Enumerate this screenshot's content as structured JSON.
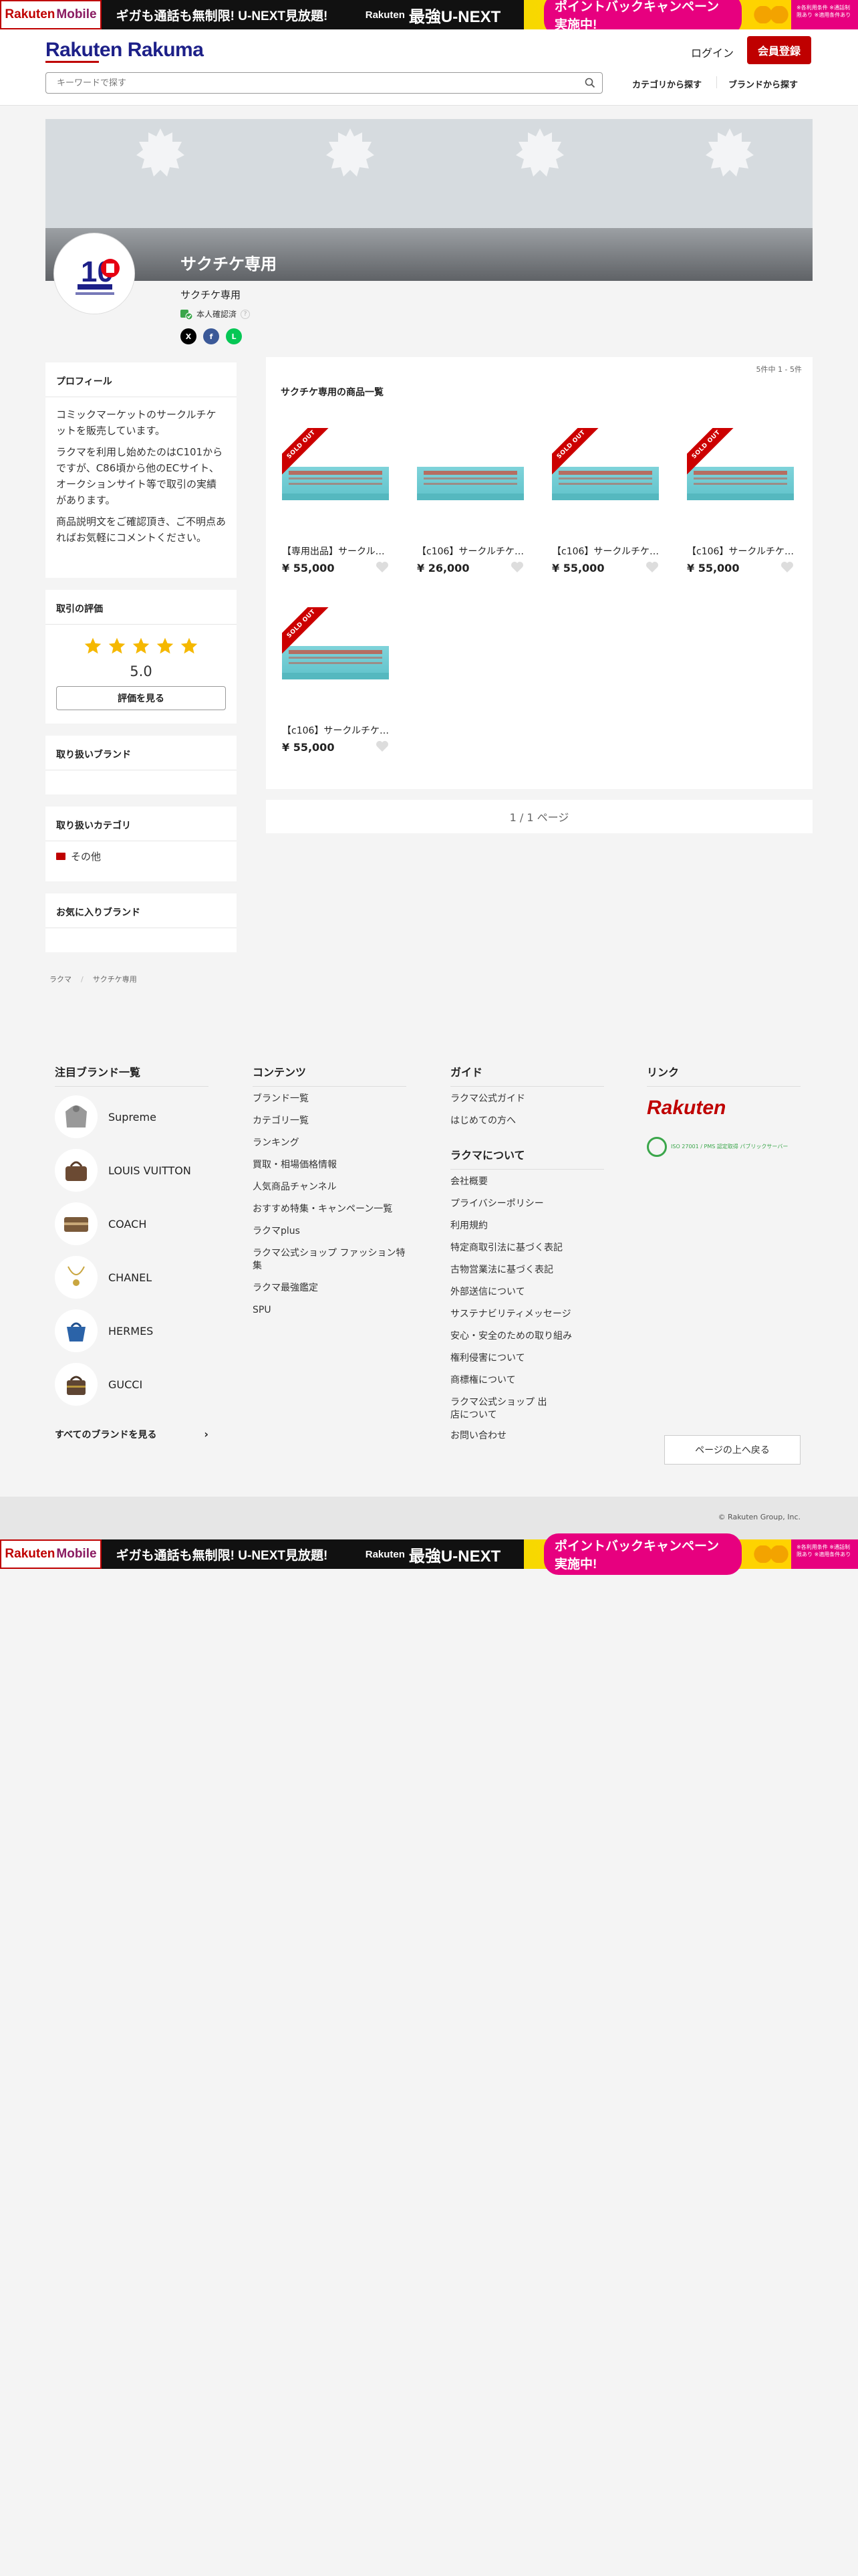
{
  "promo": {
    "rm_logo_a": "Rakuten",
    "rm_logo_b": "Mobile",
    "text1": "ギガも通話も無制限! U-NEXT見放題!",
    "text2_prefix": "Rakuten",
    "text2": "最強U-NEXT",
    "campaign": "ポイントバックキャンペーン実施中!",
    "fineprint": "※各利用条件 ※通話制限あり ※適用条件あり"
  },
  "header": {
    "brand": "Rakuten Rakuma",
    "login": "ログイン",
    "signup": "会員登録",
    "search_placeholder": "キーワードで探す",
    "nav_category": "カテゴリから探す",
    "nav_brand": "ブランドから探す"
  },
  "shop": {
    "cover_title": "サクチケ専用",
    "name": "サクチケ専用",
    "verified": "本人確認済",
    "share_x": "X",
    "share_fb": "f",
    "share_line": "L"
  },
  "profile": {
    "title": "プロフィール",
    "p1": "コミックマーケットのサークルチケットを販売しています。",
    "p2": "ラクマを利用し始めたのはC101からですが、C86頃から他のECサイト、オークションサイト等で取引の実績があります。",
    "p3": "商品説明文をご確認頂き、ご不明点あればお気軽にコメントください。"
  },
  "rating": {
    "title": "取引の評価",
    "value": "5.0",
    "stars": 5,
    "button": "評価を見る"
  },
  "brands_card": {
    "title": "取り扱いブランド"
  },
  "categories_card": {
    "title": "取り扱いカテゴリ",
    "items": [
      "その他"
    ]
  },
  "fav_brands_card": {
    "title": "お気に入りブランド"
  },
  "products": {
    "count": "5件中 1 - 5件",
    "title": "サクチケ専用の商品一覧",
    "soldout_label": "SOLD OUT",
    "items": [
      {
        "name": "【専用出品】サークルチケット",
        "price": "¥ 55,000",
        "sold_out": true
      },
      {
        "name": "【c106】サークルチケット",
        "price": "¥ 26,000",
        "sold_out": false
      },
      {
        "name": "【c106】サークルチケット",
        "price": "¥ 55,000",
        "sold_out": true
      },
      {
        "name": "【c106】サークルチケット",
        "price": "¥ 55,000",
        "sold_out": true
      },
      {
        "name": "【c106】サークルチケット",
        "price": "¥ 55,000",
        "sold_out": true
      }
    ]
  },
  "pager": "1 / 1 ページ",
  "breadcrumb": [
    "ラクマ",
    "サクチケ専用"
  ],
  "footer": {
    "brands_title": "注目ブランド一覧",
    "brands": [
      "Supreme",
      "LOUIS VUITTON",
      "COACH",
      "CHANEL",
      "HERMES",
      "GUCCI"
    ],
    "all_brands": "すべてのブランドを見る",
    "contents_title": "コンテンツ",
    "contents": [
      "ブランド一覧",
      "カテゴリ一覧",
      "ランキング",
      "買取・相場価格情報",
      "人気商品チャンネル",
      "おすすめ特集・キャンペーン一覧",
      "ラクマplus",
      "ラクマ公式ショップ ファッション特集",
      "ラクマ最強鑑定",
      "SPU"
    ],
    "guide_title": "ガイド",
    "guide": [
      "ラクマ公式ガイド",
      "はじめての方へ"
    ],
    "about_title": "ラクマについて",
    "about": [
      "会社概要",
      "プライバシーポリシー",
      "利用規約",
      "特定商取引法に基づく表記",
      "古物営業法に基づく表記",
      "外部送信について",
      "サステナビリティメッセージ",
      "安心・安全のための取り組み",
      "権利侵害について",
      "商標権について",
      "ラクマ公式ショップ 出店について",
      "お問い合わせ"
    ],
    "links_title": "リンク",
    "rakuten_logo": "Rakuten",
    "privacy_mark_text": "ISO 27001 / PMS 認定取得 パブリックサーバー",
    "to_top": "ページの上へ戻る",
    "copyright": "© Rakuten Group, Inc."
  }
}
